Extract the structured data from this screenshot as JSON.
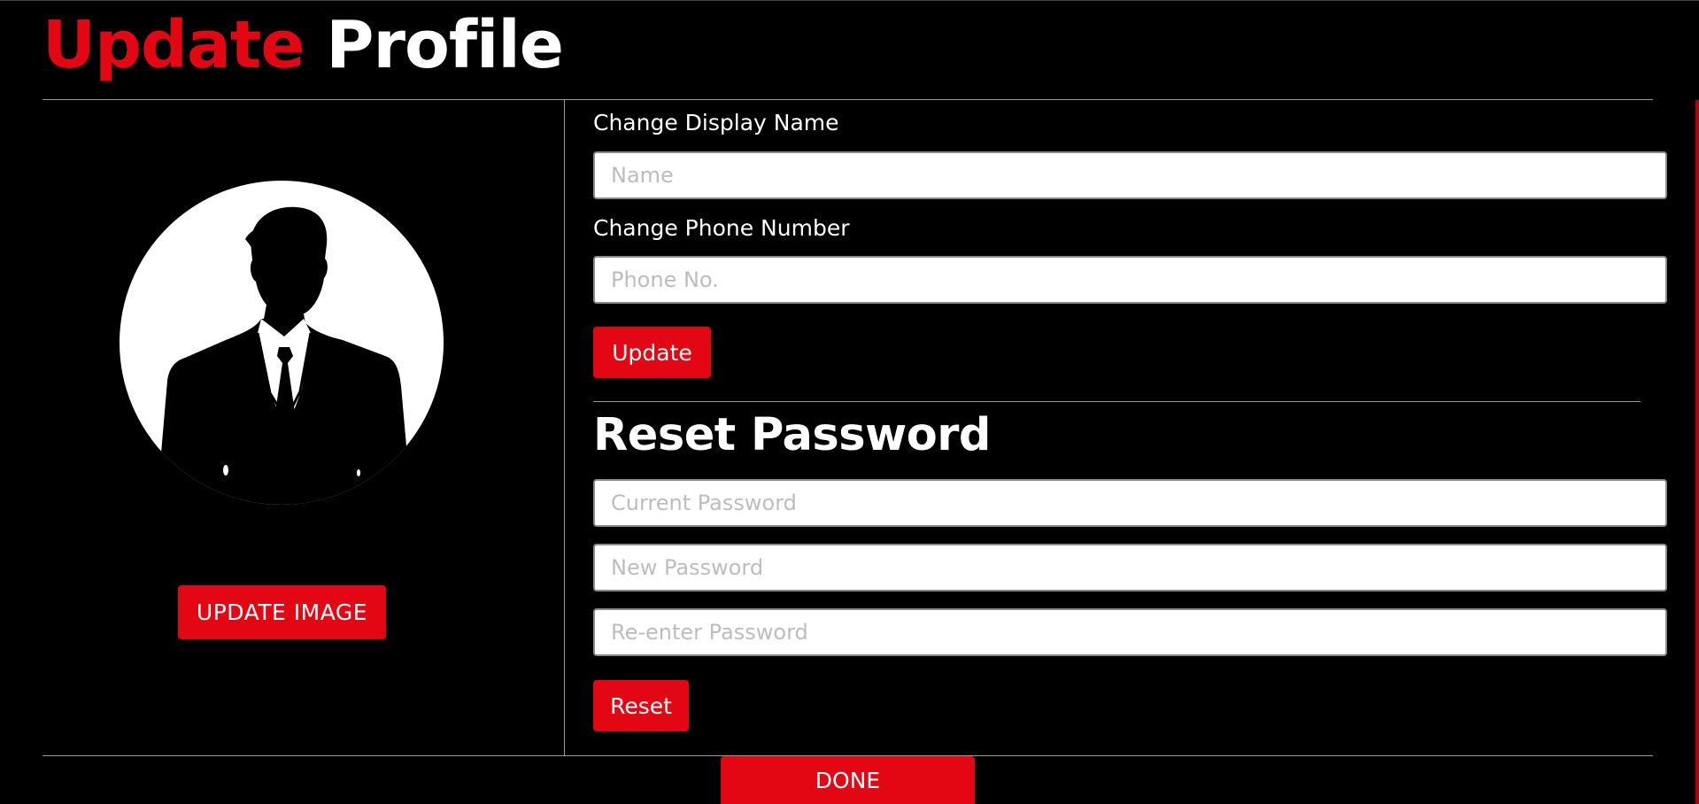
{
  "header": {
    "title_accent": "Update",
    "title_rest": "Profile"
  },
  "profile_image": {
    "update_button": "UPDATE IMAGE"
  },
  "display_name": {
    "label": "Change Display Name",
    "placeholder": "Name"
  },
  "phone": {
    "label": "Change Phone Number",
    "placeholder": "Phone No."
  },
  "update_button": "Update",
  "reset_password": {
    "title": "Reset Password",
    "current_placeholder": "Current Password",
    "new_placeholder": "New Password",
    "reenter_placeholder": "Re-enter Password",
    "reset_button": "Reset"
  },
  "done_button": "DONE",
  "colors": {
    "accent": "#e30613",
    "background": "#000000",
    "text": "#ffffff",
    "divider": "#9a9a9a"
  },
  "icons": {
    "avatar": "user-silhouette-icon"
  }
}
